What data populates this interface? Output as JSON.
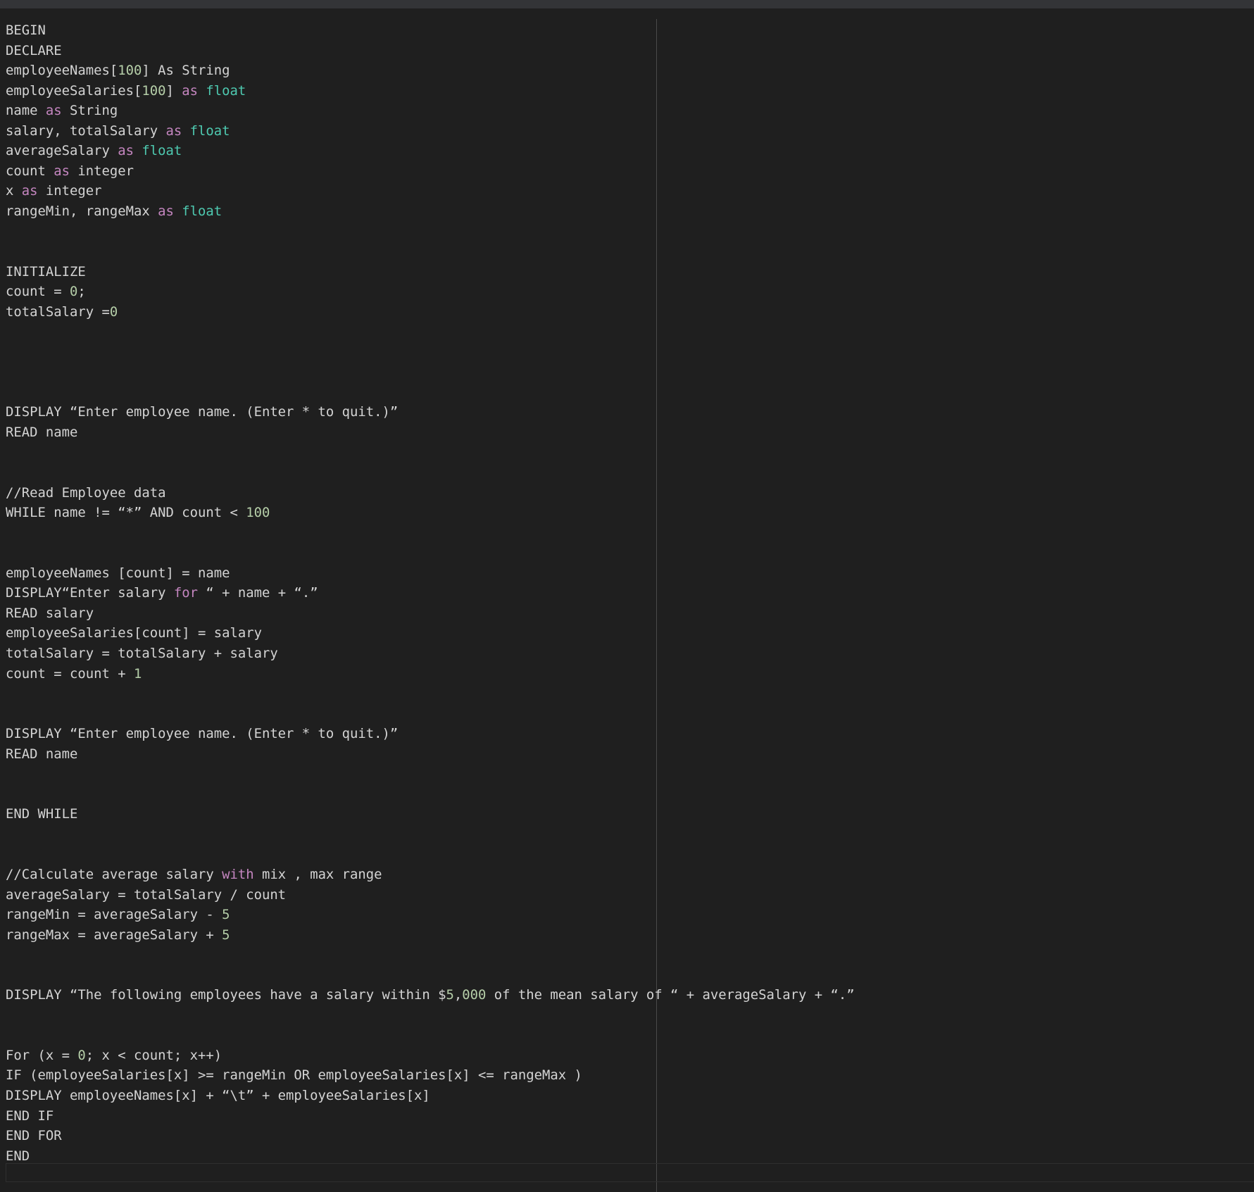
{
  "colors": {
    "background": "#1f1f1f",
    "top_bar": "#333437",
    "text": "#d4d4d4",
    "keyword": "#c586c0",
    "type": "#4ec9b0",
    "number": "#b5cea8"
  },
  "lines": [
    [
      {
        "t": "BEGIN"
      }
    ],
    [
      {
        "t": "DECLARE"
      }
    ],
    [
      {
        "t": "employeeNames["
      },
      {
        "t": "100",
        "c": "num"
      },
      {
        "t": "] As String"
      }
    ],
    [
      {
        "t": "employeeSalaries["
      },
      {
        "t": "100",
        "c": "num"
      },
      {
        "t": "] "
      },
      {
        "t": "as",
        "c": "kw"
      },
      {
        "t": " "
      },
      {
        "t": "float",
        "c": "ty"
      }
    ],
    [
      {
        "t": "name "
      },
      {
        "t": "as",
        "c": "kw"
      },
      {
        "t": " String"
      }
    ],
    [
      {
        "t": "salary, totalSalary "
      },
      {
        "t": "as",
        "c": "kw"
      },
      {
        "t": " "
      },
      {
        "t": "float",
        "c": "ty"
      }
    ],
    [
      {
        "t": "averageSalary "
      },
      {
        "t": "as",
        "c": "kw"
      },
      {
        "t": " "
      },
      {
        "t": "float",
        "c": "ty"
      }
    ],
    [
      {
        "t": "count "
      },
      {
        "t": "as",
        "c": "kw"
      },
      {
        "t": " integer"
      }
    ],
    [
      {
        "t": "x "
      },
      {
        "t": "as",
        "c": "kw"
      },
      {
        "t": " integer"
      }
    ],
    [
      {
        "t": "rangeMin, rangeMax "
      },
      {
        "t": "as",
        "c": "kw"
      },
      {
        "t": " "
      },
      {
        "t": "float",
        "c": "ty"
      }
    ],
    [],
    [],
    [
      {
        "t": "INITIALIZE"
      }
    ],
    [
      {
        "t": "count = "
      },
      {
        "t": "0",
        "c": "num"
      },
      {
        "t": ";"
      }
    ],
    [
      {
        "t": "totalSalary ="
      },
      {
        "t": "0",
        "c": "num"
      }
    ],
    [],
    [],
    [],
    [],
    [
      {
        "t": "DISPLAY “Enter employee name. (Enter * to quit.)”"
      }
    ],
    [
      {
        "t": "READ name"
      }
    ],
    [],
    [],
    [
      {
        "t": "//Read Employee data"
      }
    ],
    [
      {
        "t": "WHILE name != “*” AND count < "
      },
      {
        "t": "100",
        "c": "num"
      }
    ],
    [],
    [],
    [
      {
        "t": "employeeNames [count] = name"
      }
    ],
    [
      {
        "t": "DISPLAY“Enter salary "
      },
      {
        "t": "for",
        "c": "kw"
      },
      {
        "t": " “ + name + “.”"
      }
    ],
    [
      {
        "t": "READ salary"
      }
    ],
    [
      {
        "t": "employeeSalaries[count] = salary"
      }
    ],
    [
      {
        "t": "totalSalary = totalSalary + salary"
      }
    ],
    [
      {
        "t": "count = count + "
      },
      {
        "t": "1",
        "c": "num"
      }
    ],
    [],
    [],
    [
      {
        "t": "DISPLAY “Enter employee name. (Enter * to quit.)”"
      }
    ],
    [
      {
        "t": "READ name"
      }
    ],
    [],
    [],
    [
      {
        "t": "END WHILE"
      }
    ],
    [],
    [],
    [
      {
        "t": "//Calculate average salary "
      },
      {
        "t": "with",
        "c": "kw"
      },
      {
        "t": " mix , max range"
      }
    ],
    [
      {
        "t": "averageSalary = totalSalary / count"
      }
    ],
    [
      {
        "t": "rangeMin = averageSalary - "
      },
      {
        "t": "5",
        "c": "num"
      }
    ],
    [
      {
        "t": "rangeMax = averageSalary + "
      },
      {
        "t": "5",
        "c": "num"
      }
    ],
    [],
    [],
    [
      {
        "t": "DISPLAY “The following employees have a salary within $"
      },
      {
        "t": "5",
        "c": "num"
      },
      {
        "t": ","
      },
      {
        "t": "000",
        "c": "num"
      },
      {
        "t": " of the mean salary of “ + averageSalary + “.”"
      }
    ],
    [],
    [],
    [
      {
        "t": "For (x = "
      },
      {
        "t": "0",
        "c": "num"
      },
      {
        "t": "; x < count; x++)"
      }
    ],
    [
      {
        "t": "IF (employeeSalaries[x] >= rangeMin OR employeeSalaries[x] <= rangeMax )"
      }
    ],
    [
      {
        "t": "DISPLAY employeeNames[x] + “\\t” + employeeSalaries[x]"
      }
    ],
    [
      {
        "t": "END IF"
      }
    ],
    [
      {
        "t": "END FOR"
      }
    ],
    [
      {
        "t": "END"
      }
    ]
  ]
}
